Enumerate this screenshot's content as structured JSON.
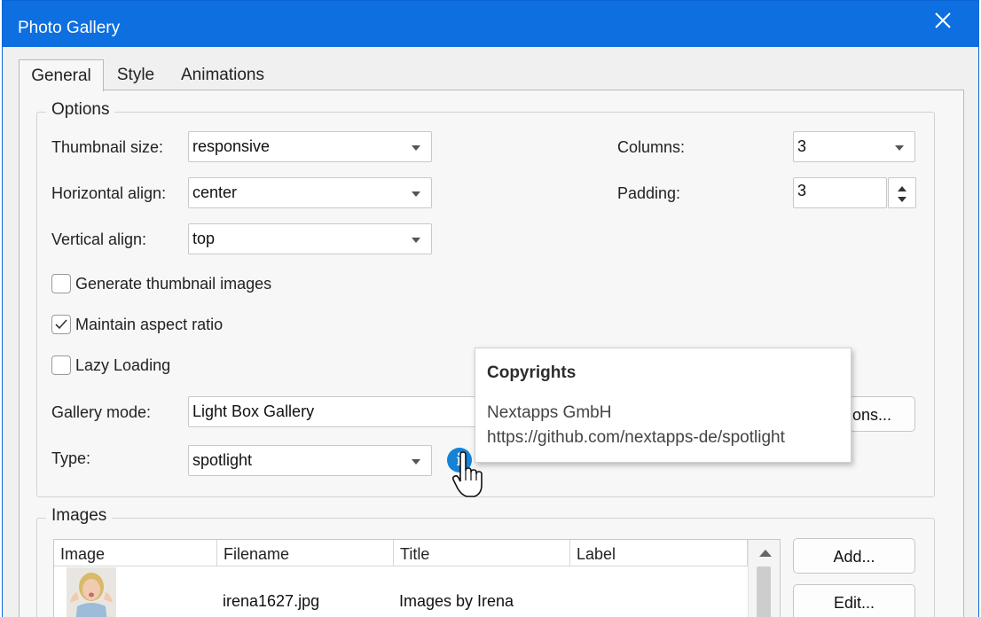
{
  "window": {
    "title": "Photo Gallery"
  },
  "tabs": [
    {
      "label": "General"
    },
    {
      "label": "Style"
    },
    {
      "label": "Animations"
    }
  ],
  "options": {
    "group_label": "Options",
    "thumbnail_size": {
      "label": "Thumbnail size:",
      "value": "responsive"
    },
    "horizontal_align": {
      "label": "Horizontal align:",
      "value": "center"
    },
    "vertical_align": {
      "label": "Vertical align:",
      "value": "top"
    },
    "columns": {
      "label": "Columns:",
      "value": "3"
    },
    "padding": {
      "label": "Padding:",
      "value": "3"
    },
    "generate_thumbnails": {
      "label": "Generate thumbnail images",
      "checked": false
    },
    "maintain_aspect": {
      "label": "Maintain aspect ratio",
      "checked": true
    },
    "lazy_loading": {
      "label": "Lazy Loading",
      "checked": false
    },
    "gallery_mode": {
      "label": "Gallery mode:",
      "value": "Light Box Gallery"
    },
    "gallery_options_button": "ons...",
    "type": {
      "label": "Type:",
      "value": "spotlight"
    }
  },
  "tooltip": {
    "title": "Copyrights",
    "line1": "Nextapps GmbH",
    "line2": "https://github.com/nextapps-de/spotlight"
  },
  "images": {
    "group_label": "Images",
    "columns": [
      "Image",
      "Filename",
      "Title",
      "Label"
    ],
    "rows": [
      {
        "filename": "irena1627.jpg",
        "title": "Images by Irena",
        "label": ""
      }
    ],
    "add_button": "Add...",
    "edit_button": "Edit..."
  },
  "colors": {
    "titlebar": "#0d6fe0",
    "info_icon": "#1582d6"
  }
}
